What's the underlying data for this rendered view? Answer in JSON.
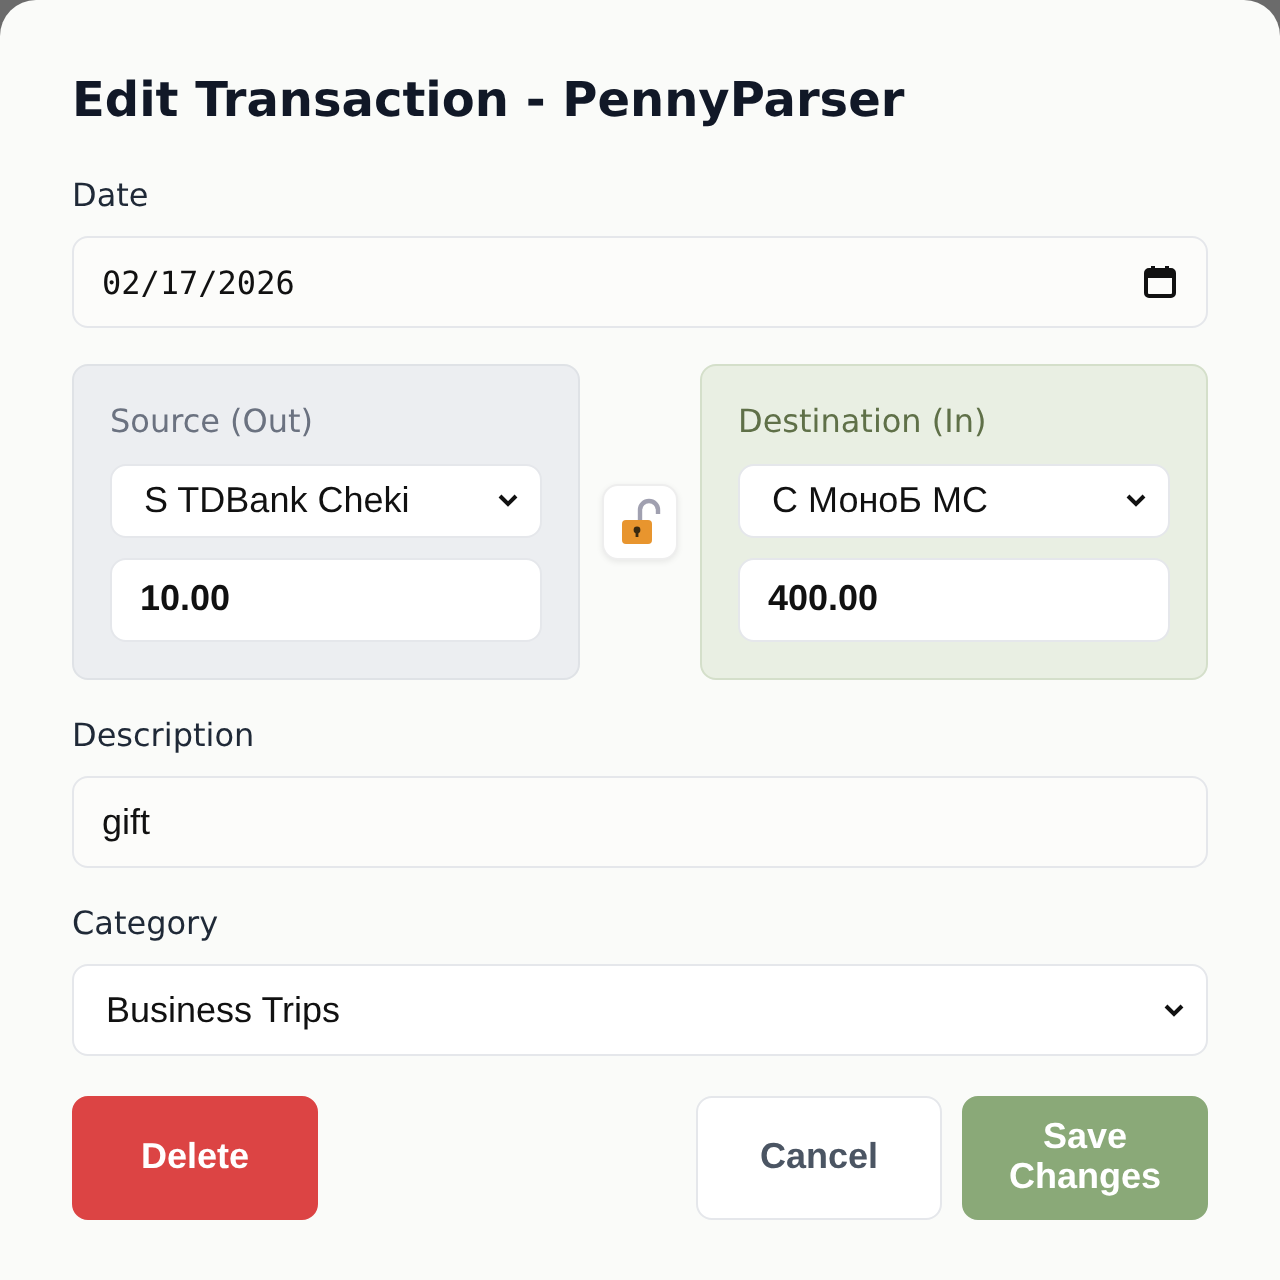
{
  "dialog": {
    "title": "Edit Transaction - PennyParser"
  },
  "date": {
    "label": "Date",
    "value": "02/17/2026"
  },
  "source": {
    "label": "Source (Out)",
    "account": "S TDBank Cheki",
    "amount": "10.00"
  },
  "destination": {
    "label": "Destination (In)",
    "account": "С МоноБ МС",
    "amount": "400.00"
  },
  "rate_lock": {
    "locked": false
  },
  "description": {
    "label": "Description",
    "value": "gift"
  },
  "category": {
    "label": "Category",
    "value": "Business Trips"
  },
  "buttons": [
    {
      "kind": "danger",
      "label": "Delete"
    },
    {
      "kind": "secondary",
      "label": "Cancel"
    },
    {
      "kind": "primary",
      "label": "Save Changes"
    }
  ]
}
